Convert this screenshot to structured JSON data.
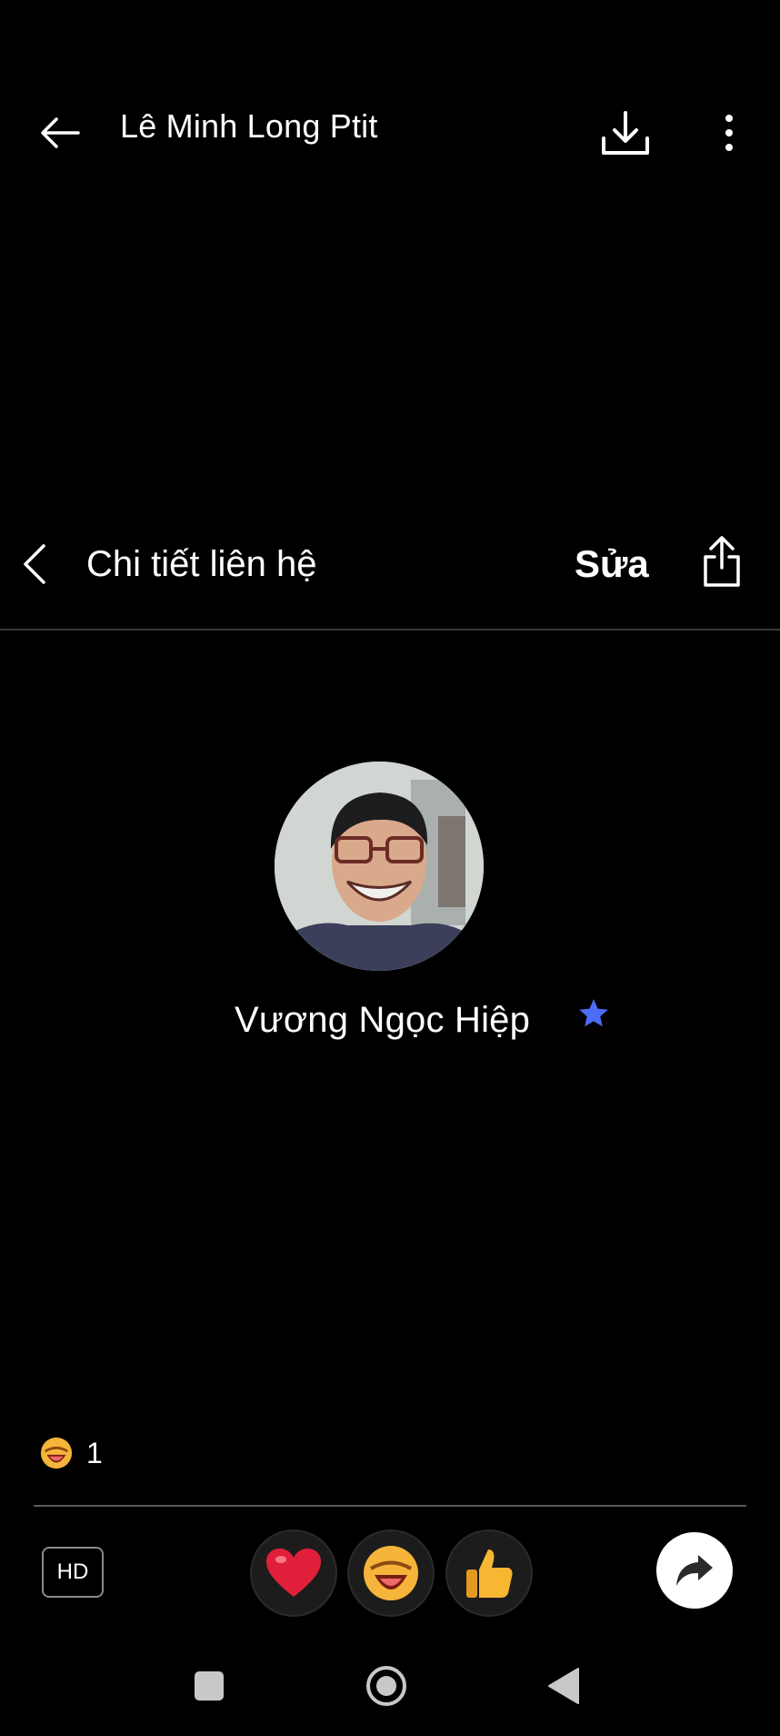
{
  "viewer": {
    "title": "Lê Minh Long Ptit"
  },
  "screenshot": {
    "title": "Chi tiết liên hệ",
    "edit_label": "Sửa",
    "contact_name": "Vương Ngọc Hiệp",
    "favorite": true
  },
  "reactions": {
    "summary_count": "1"
  },
  "actions": {
    "hd_label": "HD"
  },
  "colors": {
    "star": "#4a6cf7",
    "background": "#000000"
  },
  "icons": [
    "back-arrow-icon",
    "download-icon",
    "more-vertical-icon",
    "chevron-left-icon",
    "share-icon",
    "star-icon",
    "heart-icon",
    "laugh-icon",
    "thumbs-up-icon",
    "forward-icon"
  ]
}
